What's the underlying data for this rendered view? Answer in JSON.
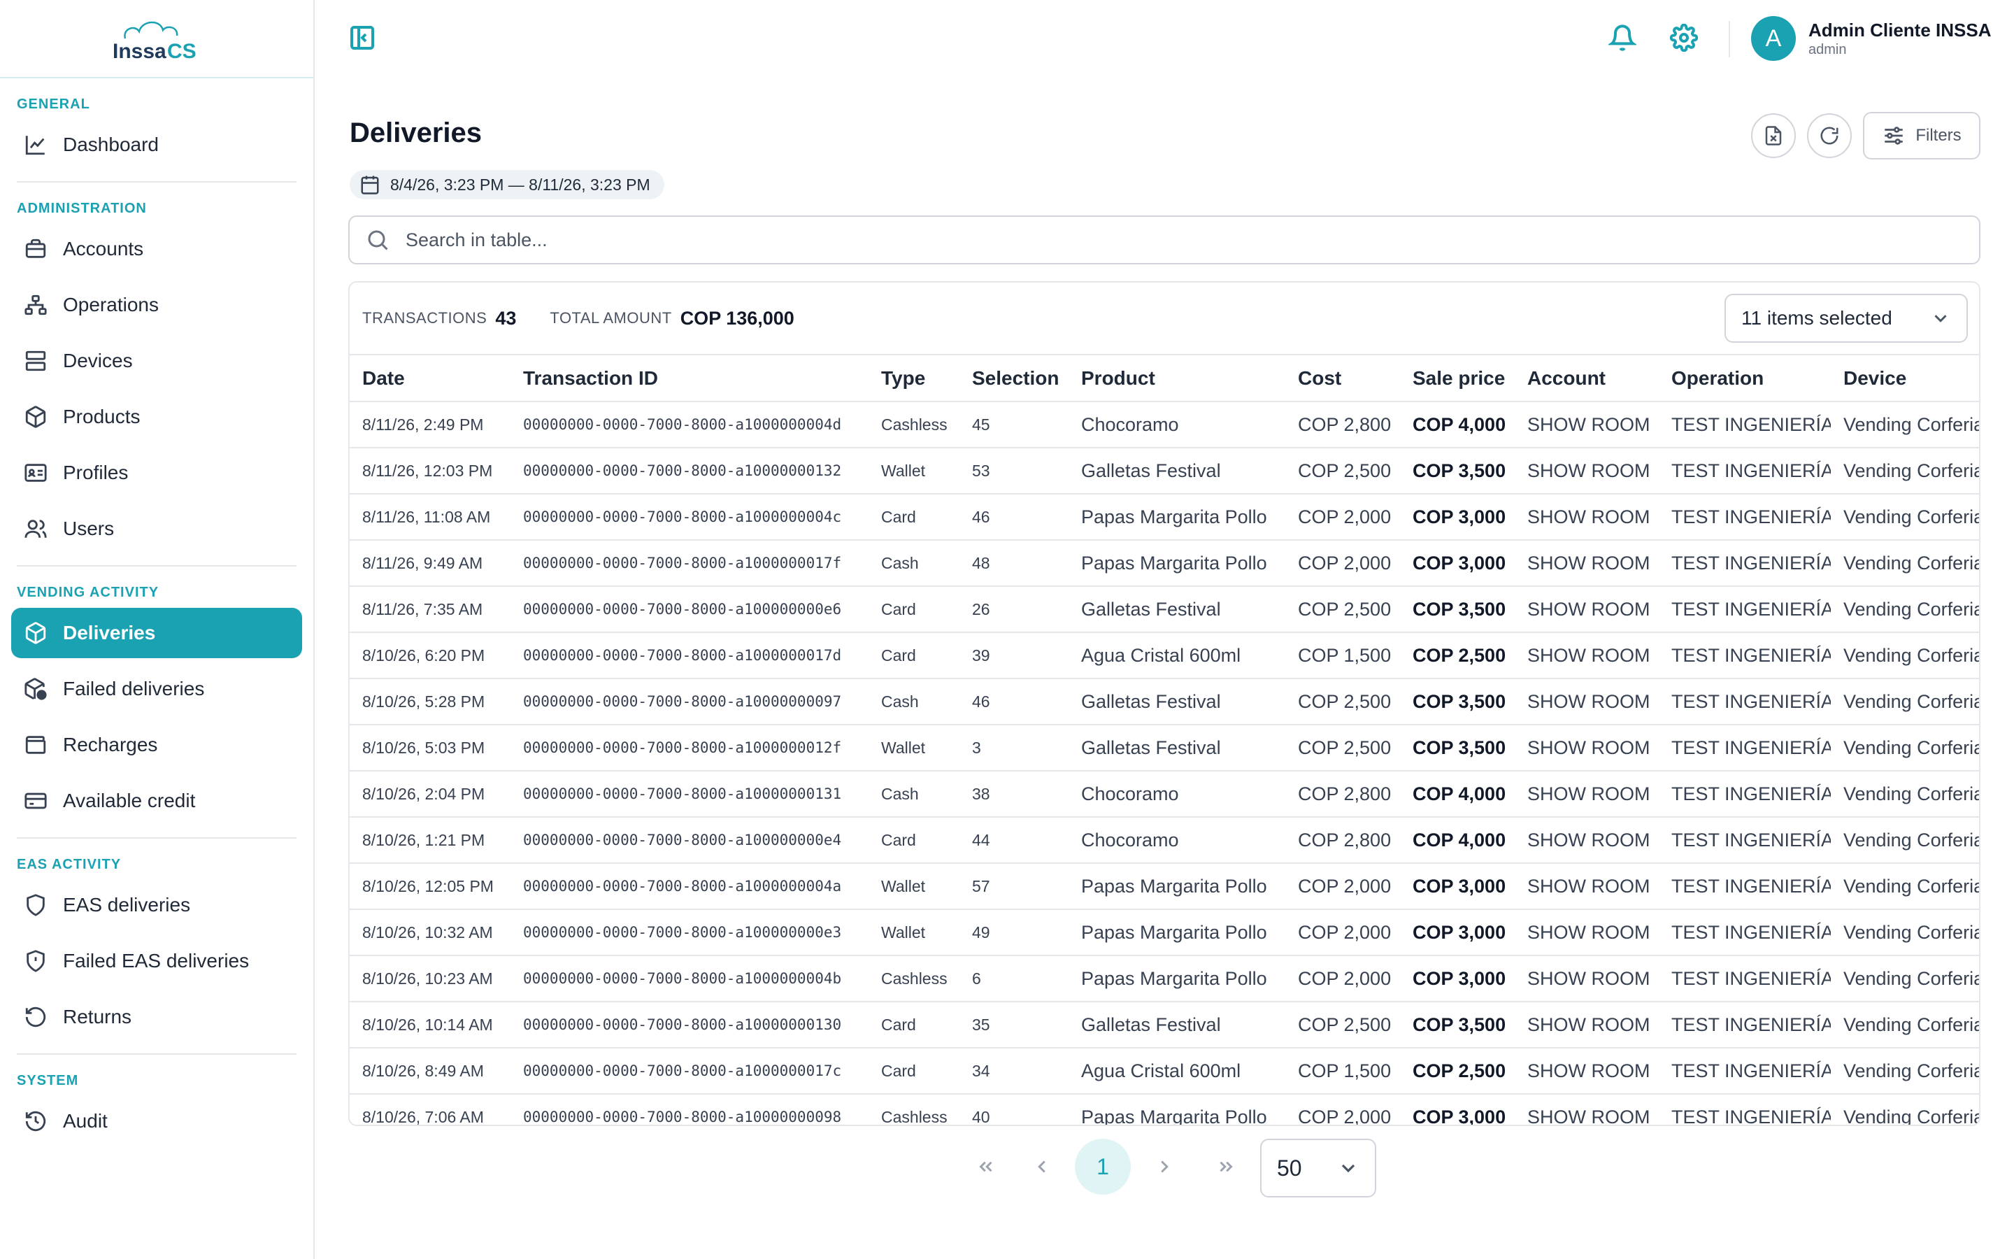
{
  "brand": {
    "logo_text": "INSSA CS",
    "accent_color": "#1aa1b2"
  },
  "sidebar": {
    "sections": [
      {
        "title": "GENERAL",
        "items": [
          {
            "label": "Dashboard",
            "icon": "chart-line-icon"
          }
        ]
      },
      {
        "title": "ADMINISTRATION",
        "items": [
          {
            "label": "Accounts",
            "icon": "briefcase-icon"
          },
          {
            "label": "Operations",
            "icon": "sitemap-icon"
          },
          {
            "label": "Devices",
            "icon": "server-icon"
          },
          {
            "label": "Products",
            "icon": "box-icon"
          },
          {
            "label": "Profiles",
            "icon": "id-card-icon"
          },
          {
            "label": "Users",
            "icon": "users-icon"
          }
        ]
      },
      {
        "title": "VENDING ACTIVITY",
        "items": [
          {
            "label": "Deliveries",
            "icon": "box-icon",
            "active": true
          },
          {
            "label": "Failed deliveries",
            "icon": "box-alert-icon"
          },
          {
            "label": "Recharges",
            "icon": "wallet-icon"
          },
          {
            "label": "Available credit",
            "icon": "credit-card-icon"
          }
        ]
      },
      {
        "title": "EAS ACTIVITY",
        "items": [
          {
            "label": "EAS deliveries",
            "icon": "shield-icon"
          },
          {
            "label": "Failed EAS deliveries",
            "icon": "shield-alert-icon"
          },
          {
            "label": "Returns",
            "icon": "undo-icon"
          }
        ]
      },
      {
        "title": "SYSTEM",
        "items": [
          {
            "label": "Audit",
            "icon": "history-icon"
          }
        ]
      }
    ]
  },
  "header": {
    "user_initial": "A",
    "user_name": "Admin Cliente INSSA",
    "user_role": "admin",
    "icons": [
      "sidebar-toggle-icon",
      "bell-icon",
      "gear-icon"
    ]
  },
  "page": {
    "title": "Deliveries",
    "date_range": "8/4/26, 3:23 PM — 8/11/26, 3:23 PM",
    "filters_label": "Filters",
    "search_placeholder": "Search in table..."
  },
  "summary": {
    "transactions_label": "TRANSACTIONS",
    "transactions_value": "43",
    "total_label": "TOTAL AMOUNT",
    "total_value": "COP 136,000",
    "columns_select": "11 items selected"
  },
  "table": {
    "columns": [
      "Date",
      "Transaction ID",
      "Type",
      "Selection",
      "Product",
      "Cost",
      "Sale price",
      "Account",
      "Operation",
      "Device"
    ],
    "rows": [
      [
        "8/11/26, 2:49 PM",
        "00000000-0000-7000-8000-a1000000004d",
        "Cashless",
        "45",
        "Chocoramo",
        "COP 2,800",
        "COP 4,000",
        "SHOW ROOM",
        "TEST INGENIERÍA",
        "Vending Corferias"
      ],
      [
        "8/11/26, 12:03 PM",
        "00000000-0000-7000-8000-a10000000132",
        "Wallet",
        "53",
        "Galletas Festival",
        "COP 2,500",
        "COP 3,500",
        "SHOW ROOM",
        "TEST INGENIERÍA",
        "Vending Corferias"
      ],
      [
        "8/11/26, 11:08 AM",
        "00000000-0000-7000-8000-a1000000004c",
        "Card",
        "46",
        "Papas Margarita Pollo",
        "COP 2,000",
        "COP 3,000",
        "SHOW ROOM",
        "TEST INGENIERÍA",
        "Vending Corferias"
      ],
      [
        "8/11/26, 9:49 AM",
        "00000000-0000-7000-8000-a1000000017f",
        "Cash",
        "48",
        "Papas Margarita Pollo",
        "COP 2,000",
        "COP 3,000",
        "SHOW ROOM",
        "TEST INGENIERÍA",
        "Vending Corferias"
      ],
      [
        "8/11/26, 7:35 AM",
        "00000000-0000-7000-8000-a100000000e6",
        "Card",
        "26",
        "Galletas Festival",
        "COP 2,500",
        "COP 3,500",
        "SHOW ROOM",
        "TEST INGENIERÍA",
        "Vending Corferias"
      ],
      [
        "8/10/26, 6:20 PM",
        "00000000-0000-7000-8000-a1000000017d",
        "Card",
        "39",
        "Agua Cristal 600ml",
        "COP 1,500",
        "COP 2,500",
        "SHOW ROOM",
        "TEST INGENIERÍA",
        "Vending Corferias"
      ],
      [
        "8/10/26, 5:28 PM",
        "00000000-0000-7000-8000-a10000000097",
        "Cash",
        "46",
        "Galletas Festival",
        "COP 2,500",
        "COP 3,500",
        "SHOW ROOM",
        "TEST INGENIERÍA",
        "Vending Corferias"
      ],
      [
        "8/10/26, 5:03 PM",
        "00000000-0000-7000-8000-a1000000012f",
        "Wallet",
        "3",
        "Galletas Festival",
        "COP 2,500",
        "COP 3,500",
        "SHOW ROOM",
        "TEST INGENIERÍA",
        "Vending Corferias"
      ],
      [
        "8/10/26, 2:04 PM",
        "00000000-0000-7000-8000-a10000000131",
        "Cash",
        "38",
        "Chocoramo",
        "COP 2,800",
        "COP 4,000",
        "SHOW ROOM",
        "TEST INGENIERÍA",
        "Vending Corferias"
      ],
      [
        "8/10/26, 1:21 PM",
        "00000000-0000-7000-8000-a100000000e4",
        "Card",
        "44",
        "Chocoramo",
        "COP 2,800",
        "COP 4,000",
        "SHOW ROOM",
        "TEST INGENIERÍA",
        "Vending Corferias"
      ],
      [
        "8/10/26, 12:05 PM",
        "00000000-0000-7000-8000-a1000000004a",
        "Wallet",
        "57",
        "Papas Margarita Pollo",
        "COP 2,000",
        "COP 3,000",
        "SHOW ROOM",
        "TEST INGENIERÍA",
        "Vending Corferias"
      ],
      [
        "8/10/26, 10:32 AM",
        "00000000-0000-7000-8000-a100000000e3",
        "Wallet",
        "49",
        "Papas Margarita Pollo",
        "COP 2,000",
        "COP 3,000",
        "SHOW ROOM",
        "TEST INGENIERÍA",
        "Vending Corferias"
      ],
      [
        "8/10/26, 10:23 AM",
        "00000000-0000-7000-8000-a1000000004b",
        "Cashless",
        "6",
        "Papas Margarita Pollo",
        "COP 2,000",
        "COP 3,000",
        "SHOW ROOM",
        "TEST INGENIERÍA",
        "Vending Corferias"
      ],
      [
        "8/10/26, 10:14 AM",
        "00000000-0000-7000-8000-a10000000130",
        "Card",
        "35",
        "Galletas Festival",
        "COP 2,500",
        "COP 3,500",
        "SHOW ROOM",
        "TEST INGENIERÍA",
        "Vending Corferias"
      ],
      [
        "8/10/26, 8:49 AM",
        "00000000-0000-7000-8000-a1000000017c",
        "Card",
        "34",
        "Agua Cristal 600ml",
        "COP 1,500",
        "COP 2,500",
        "SHOW ROOM",
        "TEST INGENIERÍA",
        "Vending Corferias"
      ],
      [
        "8/10/26, 7:06 AM",
        "00000000-0000-7000-8000-a10000000098",
        "Cashless",
        "40",
        "Papas Margarita Pollo",
        "COP 2,000",
        "COP 3,000",
        "SHOW ROOM",
        "TEST INGENIERÍA",
        "Vending Corferias"
      ]
    ]
  },
  "pagination": {
    "current_page": "1",
    "page_size": "50"
  }
}
